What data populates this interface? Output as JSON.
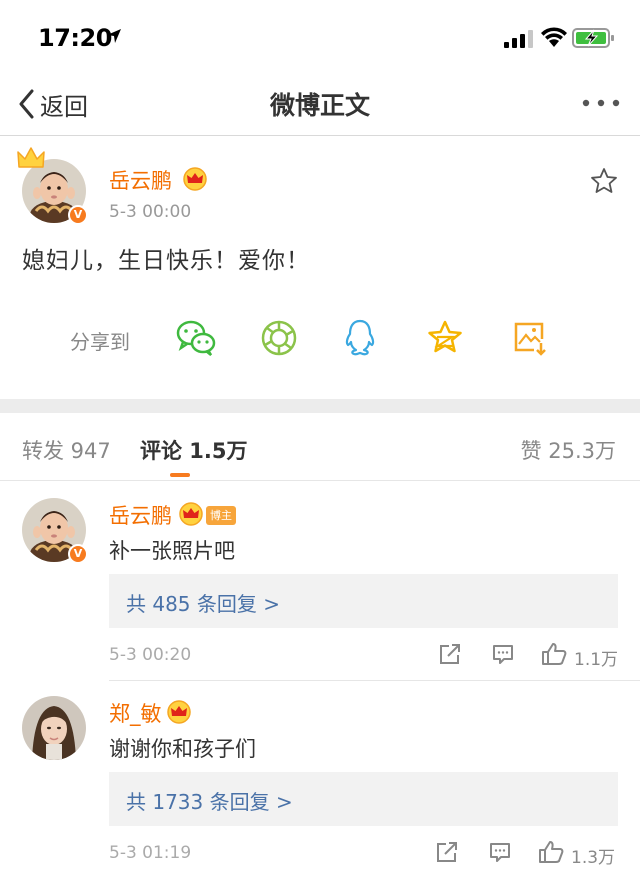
{
  "status_bar": {
    "time": "17:20"
  },
  "nav": {
    "back_label": "返回",
    "title": "微博正文"
  },
  "post": {
    "author": "岳云鹏",
    "time": "5-3 00:00",
    "text": "媳妇儿，生日快乐！爱你！",
    "verified_badge": "V",
    "share_label": "分享到",
    "share_targets": [
      "wechat-icon",
      "moments-icon",
      "qq-icon",
      "qzone-icon",
      "save-image-icon"
    ]
  },
  "tabs": {
    "repost": "转发 947",
    "comment": "评论 1.5万",
    "like": "赞 25.3万"
  },
  "comments": [
    {
      "author": "岳云鹏",
      "host_badge": "博主",
      "text": "补一张照片吧",
      "replies": "共 485 条回复 >",
      "time": "5-3 00:20",
      "likes": "1.1万",
      "verified_badge": "V"
    },
    {
      "author": "郑_敏",
      "text": "谢谢你和孩子们",
      "replies": "共 1733 条回复 >",
      "time": "5-3 01:19",
      "likes": "1.3万"
    }
  ],
  "colors": {
    "accent": "#f77b1f",
    "name": "#f36e00",
    "link": "#4a72a8",
    "band": "#ececec"
  }
}
